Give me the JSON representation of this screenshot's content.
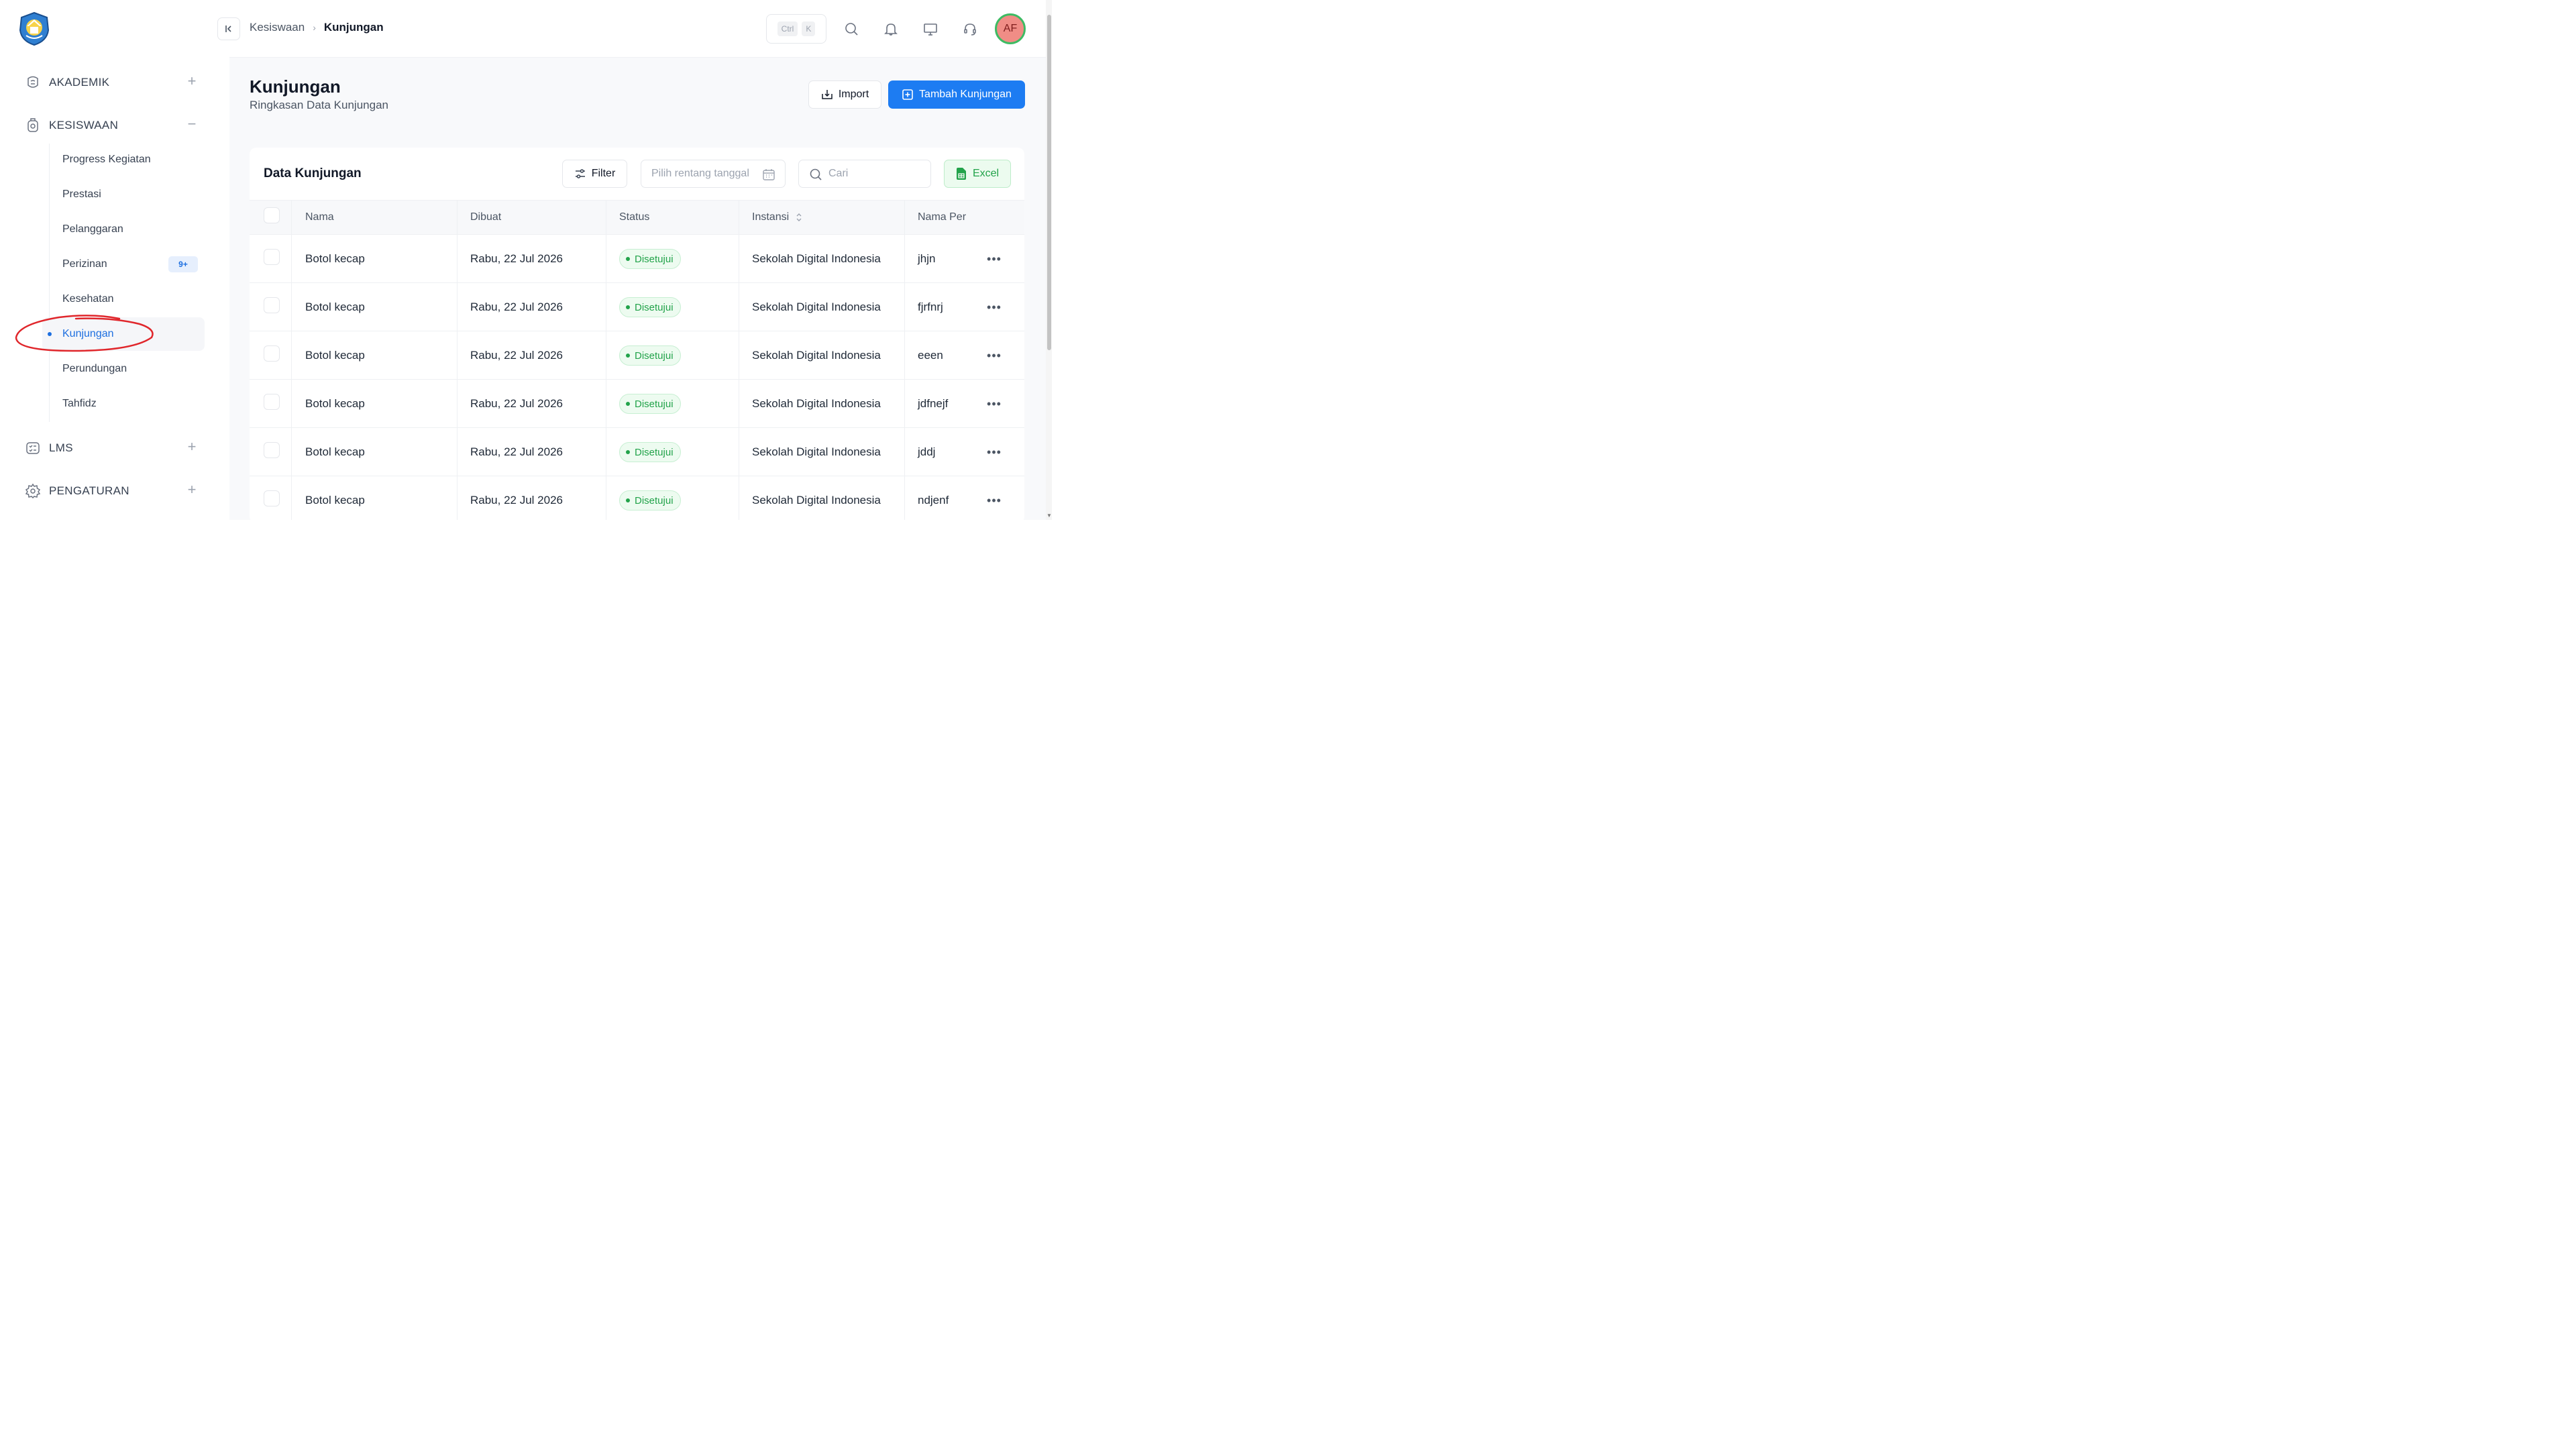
{
  "breadcrumb": {
    "parent": "Kesiswaan",
    "current": "Kunjungan"
  },
  "shortcut": {
    "key1": "Ctrl",
    "key2": "K"
  },
  "user": {
    "initials": "AF"
  },
  "sidebar": {
    "sections": [
      {
        "label": "AKADEMIK",
        "icon": "academic-icon",
        "toggle": "+"
      },
      {
        "label": "KESISWAAN",
        "icon": "student-icon",
        "toggle": "−"
      },
      {
        "label": "LMS",
        "icon": "lms-icon",
        "toggle": "+"
      },
      {
        "label": "PENGATURAN",
        "icon": "gear-icon",
        "toggle": "+"
      }
    ],
    "items": [
      {
        "label": "Progress Kegiatan"
      },
      {
        "label": "Prestasi"
      },
      {
        "label": "Pelanggaran"
      },
      {
        "label": "Perizinan",
        "badge": "9+"
      },
      {
        "label": "Kesehatan"
      },
      {
        "label": "Kunjungan",
        "active": true
      },
      {
        "label": "Perundungan"
      },
      {
        "label": "Tahfidz"
      }
    ]
  },
  "page": {
    "title": "Kunjungan",
    "subtitle": "Ringkasan Data Kunjungan",
    "import_label": "Import",
    "add_label": "Tambah Kunjungan"
  },
  "table": {
    "title": "Data Kunjungan",
    "filter_label": "Filter",
    "date_placeholder": "Pilih rentang tanggal",
    "search_placeholder": "Cari",
    "excel_label": "Excel",
    "columns": [
      "Nama",
      "Dibuat",
      "Status",
      "Instansi",
      "Nama Per"
    ],
    "rows": [
      {
        "nama": "Botol kecap",
        "dibuat": "Rabu, 22 Jul 2026",
        "status": "Disetujui",
        "instansi": "Sekolah Digital Indonesia",
        "nama_per": "jhjn"
      },
      {
        "nama": "Botol kecap",
        "dibuat": "Rabu, 22 Jul 2026",
        "status": "Disetujui",
        "instansi": "Sekolah Digital Indonesia",
        "nama_per": "fjrfnrj"
      },
      {
        "nama": "Botol kecap",
        "dibuat": "Rabu, 22 Jul 2026",
        "status": "Disetujui",
        "instansi": "Sekolah Digital Indonesia",
        "nama_per": "eeen"
      },
      {
        "nama": "Botol kecap",
        "dibuat": "Rabu, 22 Jul 2026",
        "status": "Disetujui",
        "instansi": "Sekolah Digital Indonesia",
        "nama_per": "jdfnejf"
      },
      {
        "nama": "Botol kecap",
        "dibuat": "Rabu, 22 Jul 2026",
        "status": "Disetujui",
        "instansi": "Sekolah Digital Indonesia",
        "nama_per": "jddj"
      },
      {
        "nama": "Botol kecap",
        "dibuat": "Rabu, 22 Jul 2026",
        "status": "Disetujui",
        "instansi": "Sekolah Digital Indonesia",
        "nama_per": "ndjenf"
      }
    ]
  },
  "colors": {
    "primary": "#1d7cf2",
    "success": "#22a34a",
    "annotation": "#e0262b"
  }
}
